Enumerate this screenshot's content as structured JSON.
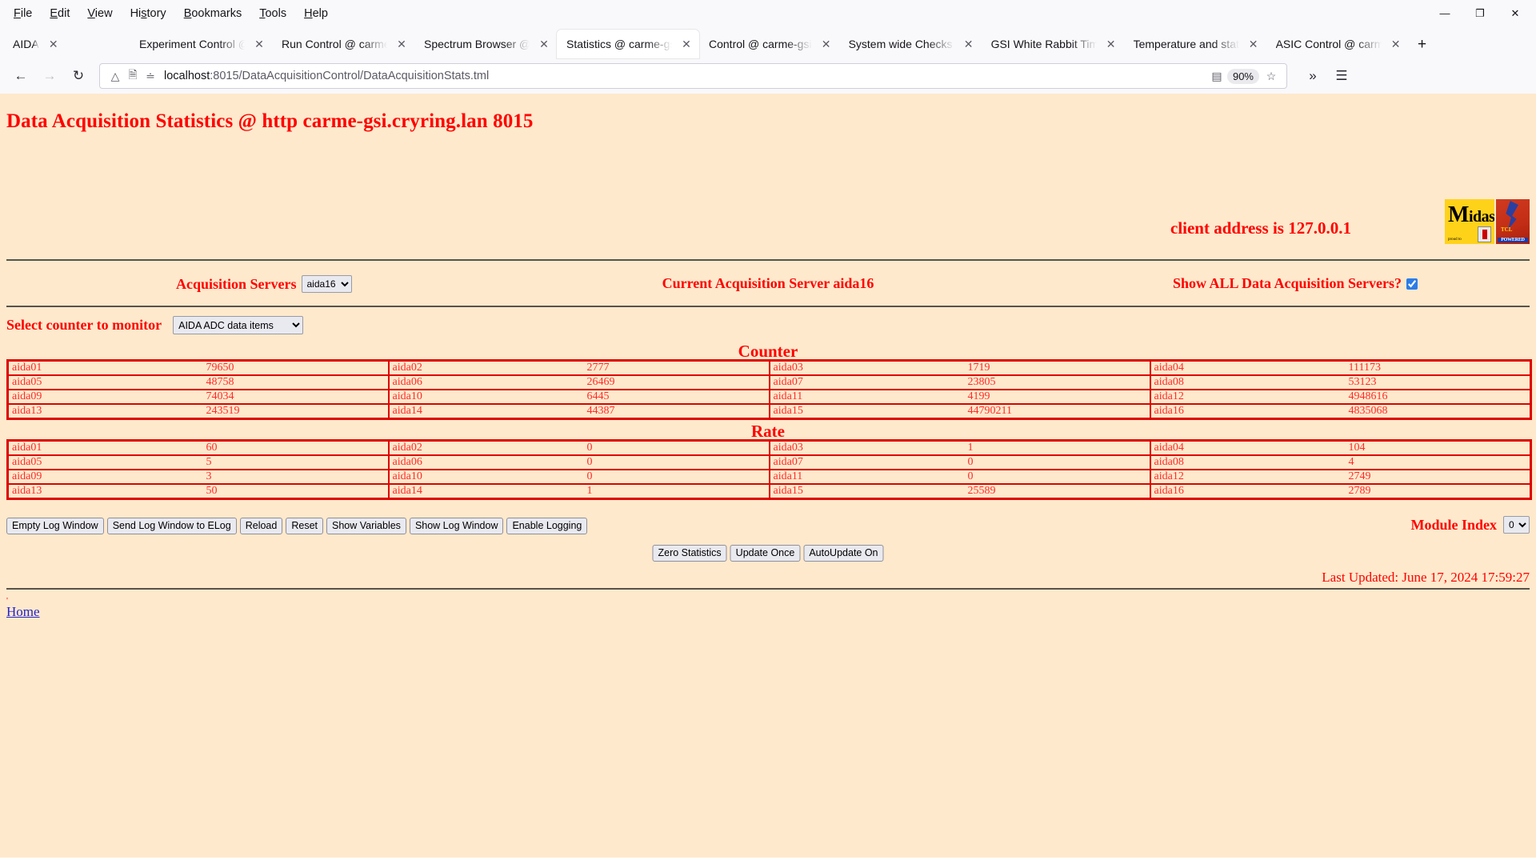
{
  "browser": {
    "menus": [
      "File",
      "Edit",
      "View",
      "History",
      "Bookmarks",
      "Tools",
      "Help"
    ],
    "window_controls": {
      "minimize": "—",
      "maximize": "❐",
      "close": "✕"
    },
    "tabs": [
      {
        "label": "AIDA",
        "active": false
      },
      {
        "label": "Experiment Control @ carme-gsi",
        "active": false
      },
      {
        "label": "Run Control @ carme-gsi",
        "active": false
      },
      {
        "label": "Spectrum Browser @ carme-gsi",
        "active": false
      },
      {
        "label": "Statistics @ carme-gsi",
        "active": true
      },
      {
        "label": "Control @ carme-gsi",
        "active": false
      },
      {
        "label": "System wide Checks @ carme",
        "active": false
      },
      {
        "label": "GSI White Rabbit Time",
        "active": false
      },
      {
        "label": "Temperature and status",
        "active": false
      },
      {
        "label": "ASIC Control @ carme-gsi",
        "active": false
      }
    ],
    "new_tab_label": "+",
    "nav": {
      "back": "←",
      "forward": "→",
      "reload": "↻",
      "url_host": "localhost",
      "url_path": ":8015/DataAcquisitionControl/DataAcquisitionStats.tml",
      "zoom_level": "90%",
      "bookmark": "☆",
      "reader": "▤",
      "overflow": "»",
      "app_menu": "☰"
    }
  },
  "page": {
    "title": "Data Acquisition Statistics @ http carme-gsi.cryring.lan 8015",
    "client_address": "client address is 127.0.0.1",
    "logo": {
      "midas_m": "M",
      "midas_rest": "idas",
      "midas_sub": "proud to",
      "tcl_text": "TCL",
      "tcl_powered": "POWERED"
    },
    "acquisition_servers_label": "Acquisition Servers",
    "acquisition_server_selected": "aida16",
    "acquisition_server_options": [
      "aida16"
    ],
    "current_server_text": "Current Acquisition Server aida16",
    "show_all_label": "Show ALL Data Acquisition Servers?",
    "show_all_checked": true,
    "select_counter_label": "Select counter to monitor",
    "counter_selected": "AIDA ADC data items",
    "counter_options": [
      "AIDA ADC data items"
    ],
    "counter_heading": "Counter",
    "rate_heading": "Rate",
    "counter_rows": [
      [
        [
          "aida01",
          "79650"
        ],
        [
          "aida02",
          "2777"
        ],
        [
          "aida03",
          "1719"
        ],
        [
          "aida04",
          "111173"
        ]
      ],
      [
        [
          "aida05",
          "48758"
        ],
        [
          "aida06",
          "26469"
        ],
        [
          "aida07",
          "23805"
        ],
        [
          "aida08",
          "53123"
        ]
      ],
      [
        [
          "aida09",
          "74034"
        ],
        [
          "aida10",
          "6445"
        ],
        [
          "aida11",
          "4199"
        ],
        [
          "aida12",
          "4948616"
        ]
      ],
      [
        [
          "aida13",
          "243519"
        ],
        [
          "aida14",
          "44387"
        ],
        [
          "aida15",
          "44790211"
        ],
        [
          "aida16",
          "4835068"
        ]
      ]
    ],
    "rate_rows": [
      [
        [
          "aida01",
          "60"
        ],
        [
          "aida02",
          "0"
        ],
        [
          "aida03",
          "1"
        ],
        [
          "aida04",
          "104"
        ]
      ],
      [
        [
          "aida05",
          "5"
        ],
        [
          "aida06",
          "0"
        ],
        [
          "aida07",
          "0"
        ],
        [
          "aida08",
          "4"
        ]
      ],
      [
        [
          "aida09",
          "3"
        ],
        [
          "aida10",
          "0"
        ],
        [
          "aida11",
          "0"
        ],
        [
          "aida12",
          "2749"
        ]
      ],
      [
        [
          "aida13",
          "50"
        ],
        [
          "aida14",
          "1"
        ],
        [
          "aida15",
          "25589"
        ],
        [
          "aida16",
          "2789"
        ]
      ]
    ],
    "left_buttons": [
      "Empty Log Window",
      "Send Log Window to ELog",
      "Reload",
      "Reset",
      "Show Variables",
      "Show Log Window",
      "Enable Logging"
    ],
    "center_buttons": [
      "Zero Statistics",
      "Update Once",
      "AutoUpdate On"
    ],
    "module_index_label": "Module Index",
    "module_index_selected": "0",
    "module_index_options": [
      "0"
    ],
    "last_updated": "Last Updated: June 17, 2024 17:59:27",
    "tiny_marker": "'",
    "home_link": "Home"
  },
  "colors": {
    "page_background": "#ffe9cc",
    "accent_red": "#ff0000",
    "table_border": "#e00000",
    "link_blue": "#2222cc",
    "rule": "#57534c"
  }
}
